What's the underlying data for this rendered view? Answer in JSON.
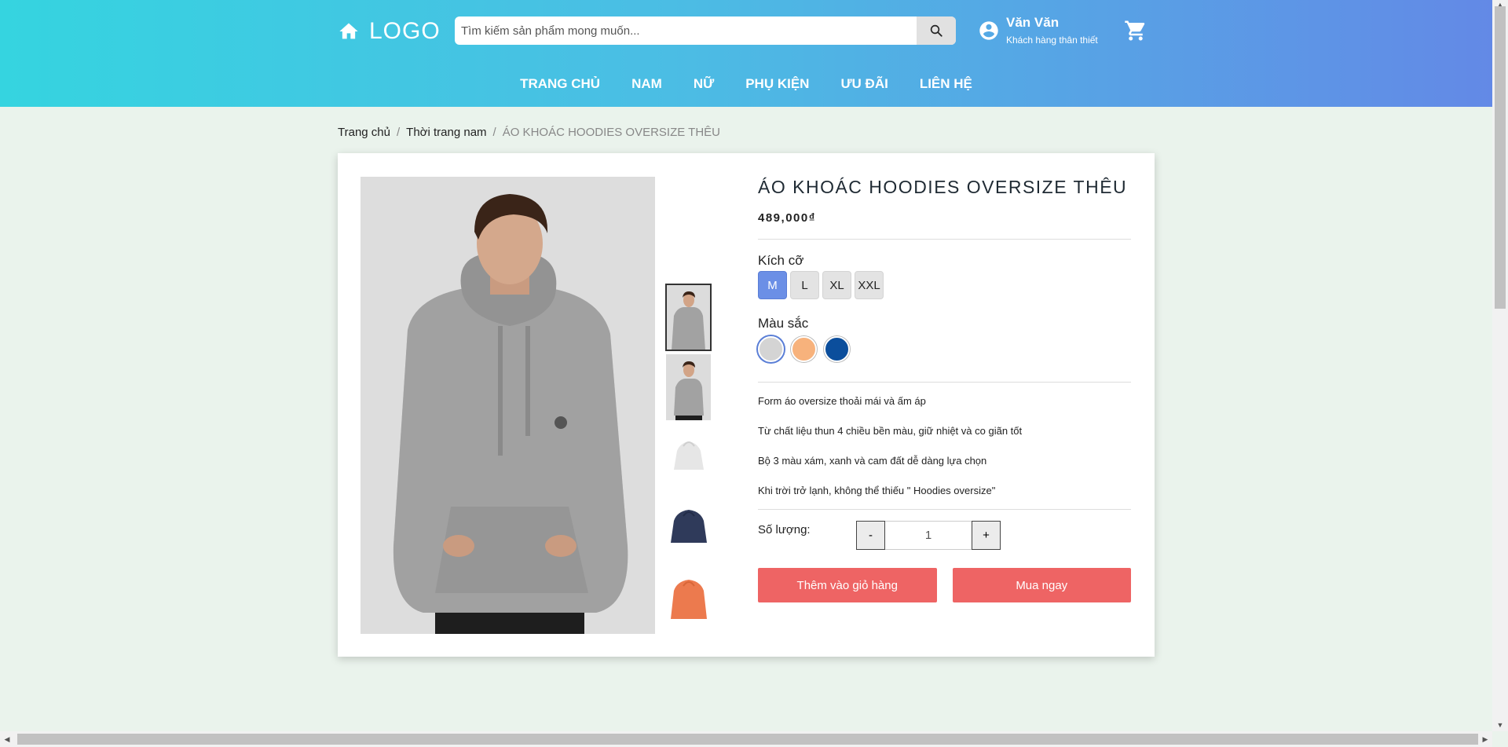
{
  "header": {
    "logo_text": "LOGO",
    "search_placeholder": "Tìm kiếm sản phẩm mong muốn...",
    "user_name": "Văn Văn",
    "user_tier": "Khách hàng thân thiết",
    "nav": [
      "TRANG CHỦ",
      "NAM",
      "NỮ",
      "PHỤ KIỆN",
      "ƯU ĐÃI",
      "LIÊN HỆ"
    ]
  },
  "breadcrumb": {
    "home": "Trang chủ",
    "category": "Thời trang nam",
    "current": "ÁO KHOÁC HOODIES OVERSIZE THÊU",
    "separator": "/"
  },
  "product": {
    "title": "ÁO KHOÁC HOODIES OVERSIZE THÊU",
    "price": "489,000₫",
    "size_label": "Kích cỡ",
    "sizes": [
      "M",
      "L",
      "XL",
      "XXL"
    ],
    "selected_size": "M",
    "color_label": "Màu sắc",
    "colors": [
      "#d4d4d4",
      "#f7b27c",
      "#0b4e9c"
    ],
    "selected_color_index": 0,
    "description": [
      "Form áo oversize thoải mái và ấm áp",
      "Từ chất liệu thun 4 chiều bền màu, giữ nhiệt và co giãn tốt",
      "Bộ 3 màu xám, xanh và cam đất dễ dàng lựa chọn",
      "Khi trời trở lạnh, không thể thiếu \" Hoodies oversize\""
    ],
    "quantity_label": "Số lượng:",
    "quantity": "1",
    "minus": "-",
    "plus": "+",
    "add_to_cart": "Thêm vào giỏ hàng",
    "buy_now": "Mua ngay"
  },
  "icons": {
    "home": "home-icon",
    "search": "search-icon",
    "user": "account-circle-icon",
    "cart": "cart-icon"
  },
  "colors": {
    "header_gradient_start": "#35d4e0",
    "header_gradient_end": "#6389e6",
    "accent_button": "#ee6464",
    "selected_size": "#6b8fe6",
    "page_background": "#eaf3ec"
  }
}
